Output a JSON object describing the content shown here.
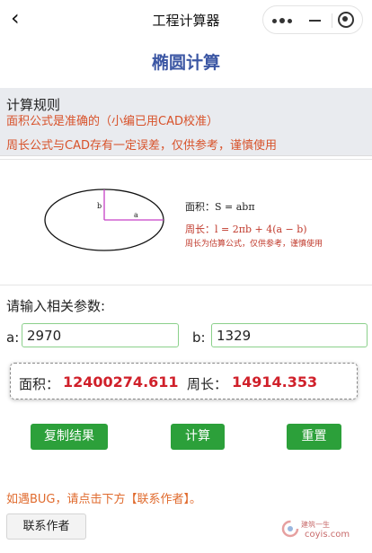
{
  "navbar": {
    "back_icon": "chevron-left-icon",
    "title": "工程计算器",
    "capsule": {
      "more_icon": "more-dots-icon",
      "minimize_icon": "minimize-icon",
      "close_icon": "target-close-icon"
    }
  },
  "page": {
    "title": "椭圆计算"
  },
  "rules": {
    "heading": "计算规则",
    "line1": "面积公式是准确的（小编已用CAD校准）",
    "line2": "周长公式与CAD存有一定误差，仅供参考，谨慎使用"
  },
  "diagram": {
    "label_a": "a",
    "label_b": "b",
    "formula_area": "面积：S = abπ",
    "formula_perimeter": "周长：l = 2πb + 4(a − b)",
    "note": "周长为估算公式，仅供参考，谨慎使用"
  },
  "inputs": {
    "prompt": "请输入相关参数:",
    "a_label": "a:",
    "a_value": "2970",
    "b_label": "b:",
    "b_value": "1329"
  },
  "result": {
    "area_label": "面积：",
    "area_value": "12400274.611",
    "perimeter_label": "周长：",
    "perimeter_value": "14914.353"
  },
  "buttons": {
    "copy": "复制结果",
    "calc": "计算",
    "reset": "重置"
  },
  "footer": {
    "bug_text": "如遇BUG，请点击下方【联系作者】。",
    "contact_button": "联系作者",
    "watermark_top": "建筑一生",
    "watermark_site": "coyis.com"
  },
  "colors": {
    "accent_title": "#3c57a4",
    "button_green": "#2ca03a",
    "result_red": "#d0202a",
    "warning_orange": "#d8522a",
    "input_border": "#8bd08b"
  }
}
